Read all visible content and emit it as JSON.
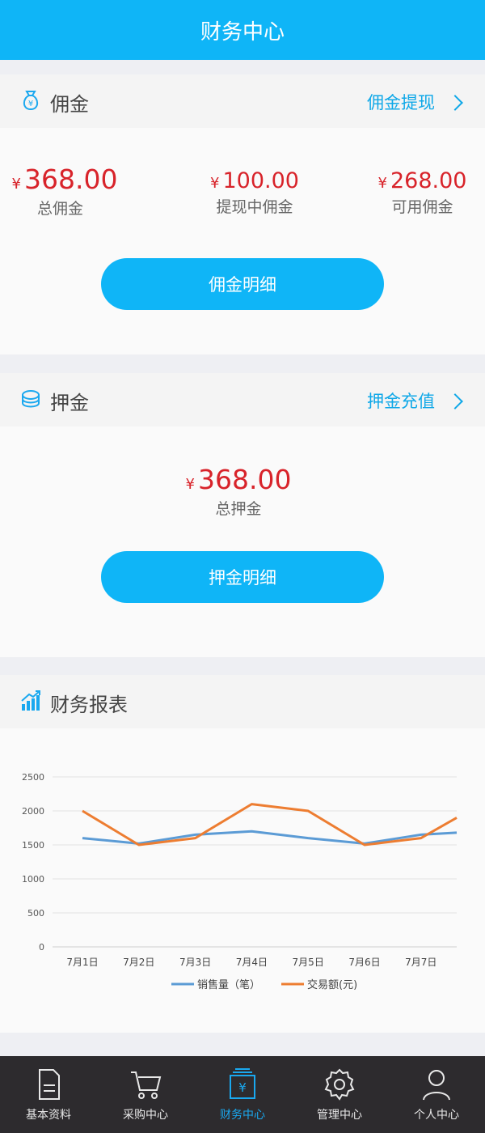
{
  "header": {
    "title": "财务中心"
  },
  "commission": {
    "title": "佣金",
    "link": "佣金提现",
    "currency": "¥",
    "items": [
      {
        "amount": "368.00",
        "label": "总佣金"
      },
      {
        "amount": "100.00",
        "label": "提现中佣金"
      },
      {
        "amount": "268.00",
        "label": "可用佣金"
      }
    ],
    "button": "佣金明细"
  },
  "deposit": {
    "title": "押金",
    "link": "押金充值",
    "currency": "¥",
    "amount": "368.00",
    "label": "总押金",
    "button": "押金明细"
  },
  "report": {
    "title": "财务报表"
  },
  "chart_data": {
    "type": "line",
    "categories": [
      "7月1日",
      "7月2日",
      "7月3日",
      "7月4日",
      "7月5日",
      "7月6日",
      "7月7日"
    ],
    "ylim": [
      0,
      2500
    ],
    "yticks": [
      0,
      500,
      1000,
      1500,
      2000,
      2500
    ],
    "grid": true,
    "legend": "bottom",
    "series": [
      {
        "name": "销售量（笔）",
        "color": "#5b9bd5",
        "values": [
          1600,
          1520,
          1650,
          1700,
          1600,
          1520,
          1650
        ],
        "end_value": 1680
      },
      {
        "name": "交易额(元)",
        "color": "#ed7d31",
        "values": [
          2000,
          1500,
          1600,
          2100,
          2000,
          1500,
          1600
        ],
        "end_value": 1900
      }
    ]
  },
  "tabbar": {
    "items": [
      {
        "label": "基本资料",
        "icon": "document-icon"
      },
      {
        "label": "采购中心",
        "icon": "cart-icon"
      },
      {
        "label": "财务中心",
        "icon": "finance-icon",
        "active": true
      },
      {
        "label": "管理中心",
        "icon": "gear-icon"
      },
      {
        "label": "个人中心",
        "icon": "person-icon"
      }
    ]
  }
}
